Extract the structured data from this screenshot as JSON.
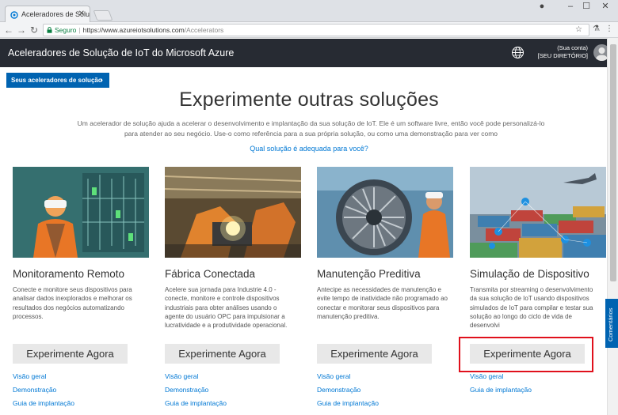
{
  "browser": {
    "tab_title": "Aceleradores de Solução",
    "secure_label": "Seguro",
    "url_host": "https://www.azureiotsolutions.com",
    "url_path": "/Accelerators"
  },
  "header": {
    "title": "Aceleradores de Solução de IoT do Microsoft Azure",
    "account_line1": "(Sua conta)",
    "account_line2": "[SEU DIRETÓRIO]"
  },
  "main": {
    "my_accelerators_button": "Seus aceleradores de solução",
    "title": "Experimente outras soluções",
    "description": "Um acelerador de solução ajuda a acelerar o desenvolvimento e implantação da sua solução de IoT. Ele é um software livre, então você pode personalizá-lo para atender ao seu negócio. Use-o como referência para a sua própria solução, ou como uma demonstração para ver como",
    "help_link": "Qual solução é adequada para você?"
  },
  "cards": [
    {
      "title": "Monitoramento Remoto",
      "description": "Conecte e monitore seus dispositivos para analisar dados inexplorados e melhorar os resultados dos negócios automatizando processos.",
      "button": "Experimente Agora",
      "links": [
        "Visão geral",
        "Demonstração",
        "Guia de implantação"
      ]
    },
    {
      "title": "Fábrica Conectada",
      "description": "Acelere sua jornada para Industrie 4.0 - conecte, monitore e controle dispositivos industriais para obter análises usando o agente do usuário OPC para impulsionar a lucratividade e a produtividade operacional.",
      "button": "Experimente Agora",
      "links": [
        "Visão geral",
        "Demonstração",
        "Guia de implantação"
      ]
    },
    {
      "title": "Manutenção Preditiva",
      "description": "Antecipe as necessidades de manutenção e evite tempo de inatividade não programado ao conectar e monitorar seus dispositivos para manutenção preditiva.",
      "button": "Experimente Agora",
      "links": [
        "Visão geral",
        "Demonstração",
        "Guia de implantação"
      ]
    },
    {
      "title": "Simulação de Dispositivo",
      "description": "Transmita por streaming o desenvolvimento da sua solução de IoT usando dispositivos simulados de IoT para compilar e testar sua solução ao longo do ciclo de vida de desenvolvi",
      "button": "Experimente Agora",
      "links": [
        "Visão geral",
        "Guia de implantação"
      ]
    }
  ],
  "feedback_label": "Comentários",
  "colors": {
    "header_bg": "#272b33",
    "accent_blue": "#0063b1",
    "link_blue": "#0078d4",
    "highlight_red": "#e0101c"
  }
}
